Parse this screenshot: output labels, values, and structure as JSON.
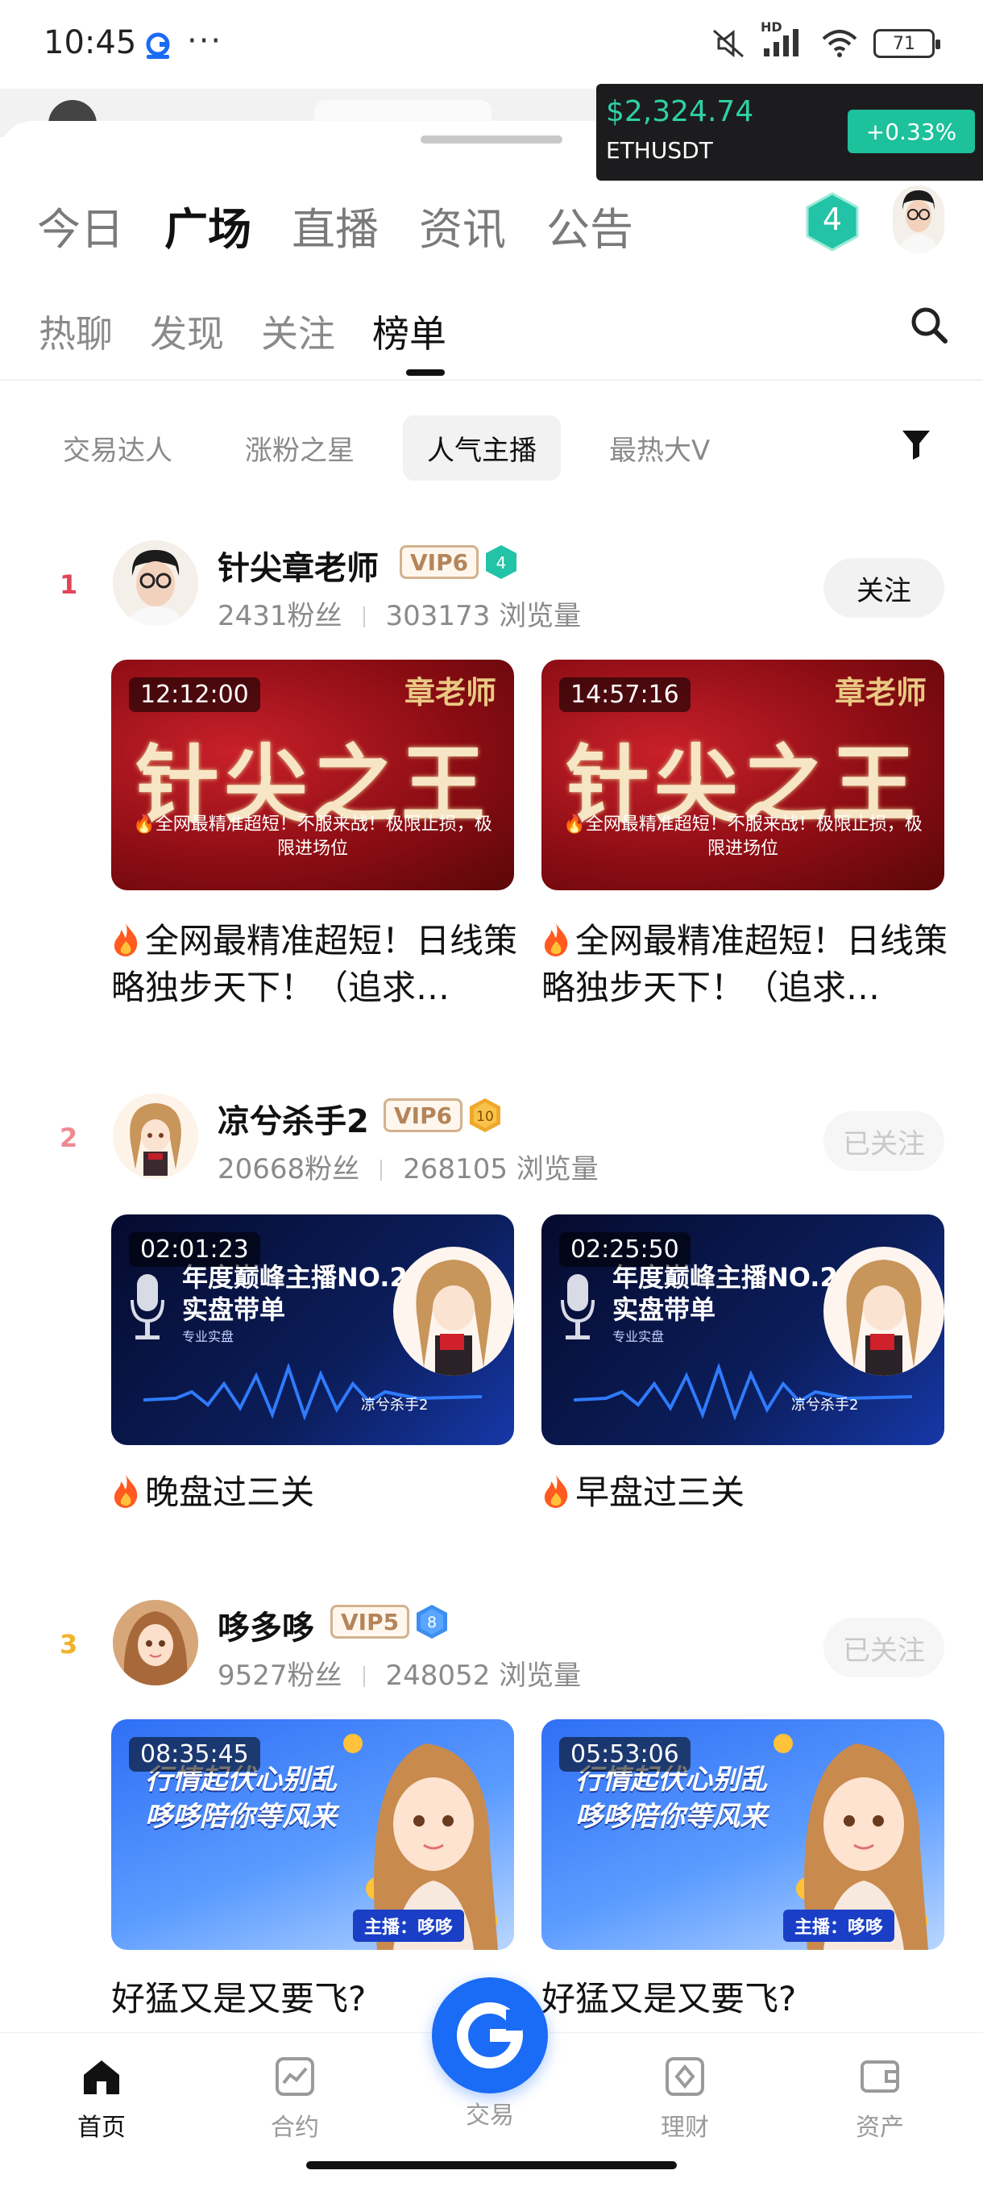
{
  "status_bar": {
    "time": "10:45",
    "more": "···",
    "network_label": "HD",
    "battery": "71"
  },
  "ticker": {
    "price": "$2,324.74",
    "symbol": "ETHUSDT",
    "change": "+0.33%",
    "up_color": "#1dc19b"
  },
  "top_tabs": [
    {
      "label": "今日",
      "active": false
    },
    {
      "label": "广场",
      "active": true
    },
    {
      "label": "直播",
      "active": false
    },
    {
      "label": "资讯",
      "active": false
    },
    {
      "label": "公告",
      "active": false
    }
  ],
  "user_level_badge": "4",
  "sub_tabs": [
    {
      "label": "热聊",
      "active": false
    },
    {
      "label": "发现",
      "active": false
    },
    {
      "label": "关注",
      "active": false
    },
    {
      "label": "榜单",
      "active": true
    }
  ],
  "filters": [
    {
      "label": "交易达人",
      "active": false
    },
    {
      "label": "涨粉之星",
      "active": false
    },
    {
      "label": "人气主播",
      "active": true
    },
    {
      "label": "最热大V",
      "active": false
    }
  ],
  "entries": [
    {
      "rank": "1",
      "rank_color": "#e0455a",
      "name": "针尖章老师",
      "vip": "VIP6",
      "level": "4",
      "fans": "2431粉丝",
      "views": "303173 浏览量",
      "follow": "关注",
      "followed": false,
      "streams": [
        {
          "duration": "12:12:00",
          "banner_title": "针尖之王",
          "banner_brand": "章老师",
          "banner_sub": "🔥全网最精准超短！不服来战！极限止损，极限进场位",
          "title": "全网最精准超短！日线策略独步天下！（追求…"
        },
        {
          "duration": "14:57:16",
          "banner_title": "针尖之王",
          "banner_brand": "章老师",
          "banner_sub": "🔥全网最精准超短！不服来战！极限止损，极限进场位",
          "title": "全网最精准超短！日线策略独步天下！（追求…"
        }
      ]
    },
    {
      "rank": "2",
      "rank_color": "#ef8a92",
      "name": "凉兮杀手2",
      "vip": "VIP6",
      "level": "10",
      "fans": "20668粉丝",
      "views": "268105 浏览量",
      "follow": "已关注",
      "followed": true,
      "streams": [
        {
          "duration": "02:01:23",
          "banner_line1": "年度巅峰主播NO.2",
          "banner_line2": "实盘带单",
          "banner_tag": "专业实盘",
          "banner_who": "凉兮杀手2",
          "title": "晚盘过三关"
        },
        {
          "duration": "02:25:50",
          "banner_line1": "年度巅峰主播NO.2",
          "banner_line2": "实盘带单",
          "banner_tag": "专业实盘",
          "banner_who": "凉兮杀手2",
          "title": "早盘过三关"
        }
      ]
    },
    {
      "rank": "3",
      "rank_color": "#f0b429",
      "name": "哆多哆",
      "vip": "VIP5",
      "level": "8",
      "fans": "9527粉丝",
      "views": "248052 浏览量",
      "follow": "已关注",
      "followed": true,
      "streams": [
        {
          "duration": "08:35:45",
          "banner_line1": "行情起伏心别乱",
          "banner_line2": "哆哆陪你等风来",
          "banner_host": "主播：哆哆",
          "title": "好猛又是又要飞?"
        },
        {
          "duration": "05:53:06",
          "banner_line1": "行情起伏心别乱",
          "banner_line2": "哆哆陪你等风来",
          "banner_host": "主播：哆哆",
          "title": "好猛又是又要飞?"
        }
      ]
    }
  ],
  "bottom_nav": [
    {
      "label": "首页",
      "icon": "home-icon",
      "active": true
    },
    {
      "label": "合约",
      "icon": "chart-icon",
      "active": false
    },
    {
      "label": "交易",
      "icon": "trade-icon",
      "active": false
    },
    {
      "label": "理财",
      "icon": "finance-icon",
      "active": false
    },
    {
      "label": "资产",
      "icon": "wallet-icon",
      "active": false
    }
  ],
  "colors": {
    "accent": "#1a6bf5",
    "teal_badge": "#22c3a6",
    "vip_border": "#d2b28e"
  }
}
